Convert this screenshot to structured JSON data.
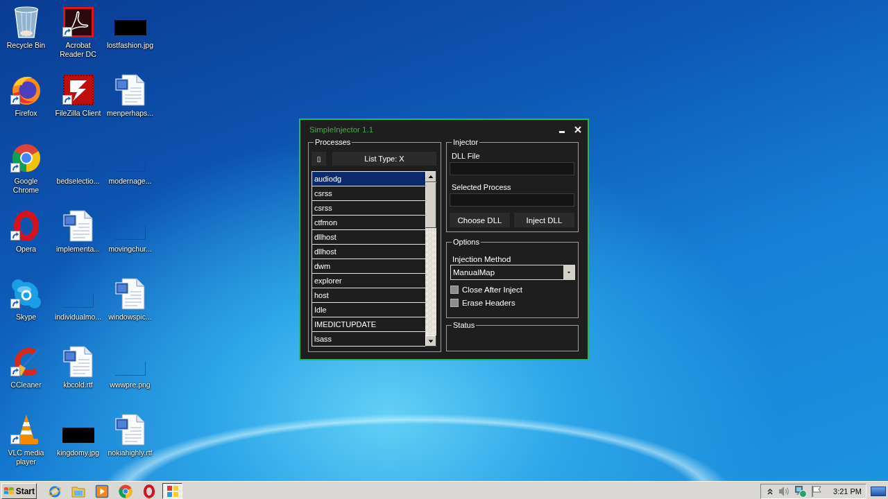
{
  "desktop": {
    "icons": [
      {
        "label": "Recycle Bin",
        "kind": "recycle",
        "shortcut": false
      },
      {
        "label": "Firefox",
        "kind": "firefox",
        "shortcut": true
      },
      {
        "label": "Google Chrome",
        "kind": "chrome",
        "shortcut": true
      },
      {
        "label": "Opera",
        "kind": "opera",
        "shortcut": true
      },
      {
        "label": "Skype",
        "kind": "skype",
        "shortcut": true
      },
      {
        "label": "CCleaner",
        "kind": "ccleaner",
        "shortcut": true
      },
      {
        "label": "VLC media player",
        "kind": "vlc",
        "shortcut": true
      },
      {
        "label": "Acrobat Reader DC",
        "kind": "acrobat",
        "shortcut": true
      },
      {
        "label": "FileZilla Client",
        "kind": "filezilla",
        "shortcut": true
      },
      {
        "label": "bedselectio...",
        "kind": "blank-image",
        "shortcut": false
      },
      {
        "label": "implementa...",
        "kind": "word",
        "shortcut": false
      },
      {
        "label": "individualmo...",
        "kind": "blank-image",
        "shortcut": false
      },
      {
        "label": "kbcold.rtf",
        "kind": "word",
        "shortcut": false
      },
      {
        "label": "kingdomy.jpg",
        "kind": "dark-image",
        "shortcut": false
      },
      {
        "label": "lostfashion.jpg",
        "kind": "dark-image",
        "shortcut": false
      },
      {
        "label": "menperhaps...",
        "kind": "word",
        "shortcut": false
      },
      {
        "label": "modernage...",
        "kind": "blank-image",
        "shortcut": false
      },
      {
        "label": "movingchur...",
        "kind": "blank-image",
        "shortcut": false
      },
      {
        "label": "windowspic...",
        "kind": "word",
        "shortcut": false
      },
      {
        "label": "wwwpre.png",
        "kind": "blank-image",
        "shortcut": false
      },
      {
        "label": "nokiahighly.rtf",
        "kind": "word",
        "shortcut": false
      }
    ]
  },
  "window": {
    "title": "SimpleInjector 1.1",
    "processes": {
      "legend": "Processes",
      "refresh_button": "▯",
      "list_type_button": "List Type: X",
      "items": [
        {
          "name": "audiodg",
          "selected": true
        },
        {
          "name": "csrss",
          "selected": false
        },
        {
          "name": "csrss",
          "selected": false
        },
        {
          "name": "ctfmon",
          "selected": false
        },
        {
          "name": "dllhost",
          "selected": false
        },
        {
          "name": "dllhost",
          "selected": false
        },
        {
          "name": "dwm",
          "selected": false
        },
        {
          "name": "explorer",
          "selected": false
        },
        {
          "name": "host",
          "selected": false
        },
        {
          "name": "Idle",
          "selected": false
        },
        {
          "name": "IMEDICTUPDATE",
          "selected": false
        },
        {
          "name": "lsass",
          "selected": false
        }
      ]
    },
    "injector": {
      "legend": "Injector",
      "fields": [
        {
          "label": "DLL File"
        },
        {
          "label": "Selected Process"
        }
      ],
      "buttons": [
        "Choose DLL",
        "Inject DLL"
      ]
    },
    "options": {
      "legend": "Options",
      "method_label": "Injection Method",
      "method_value": "ManualMap",
      "checkboxes": [
        {
          "label": "Close After Inject",
          "checked": false
        },
        {
          "label": "Erase Headers",
          "checked": false
        }
      ]
    },
    "status": {
      "legend": "Status"
    }
  },
  "taskbar": {
    "start_button": "Start",
    "tasks": [
      {
        "selected": true
      }
    ],
    "clock": "3:21 PM"
  }
}
